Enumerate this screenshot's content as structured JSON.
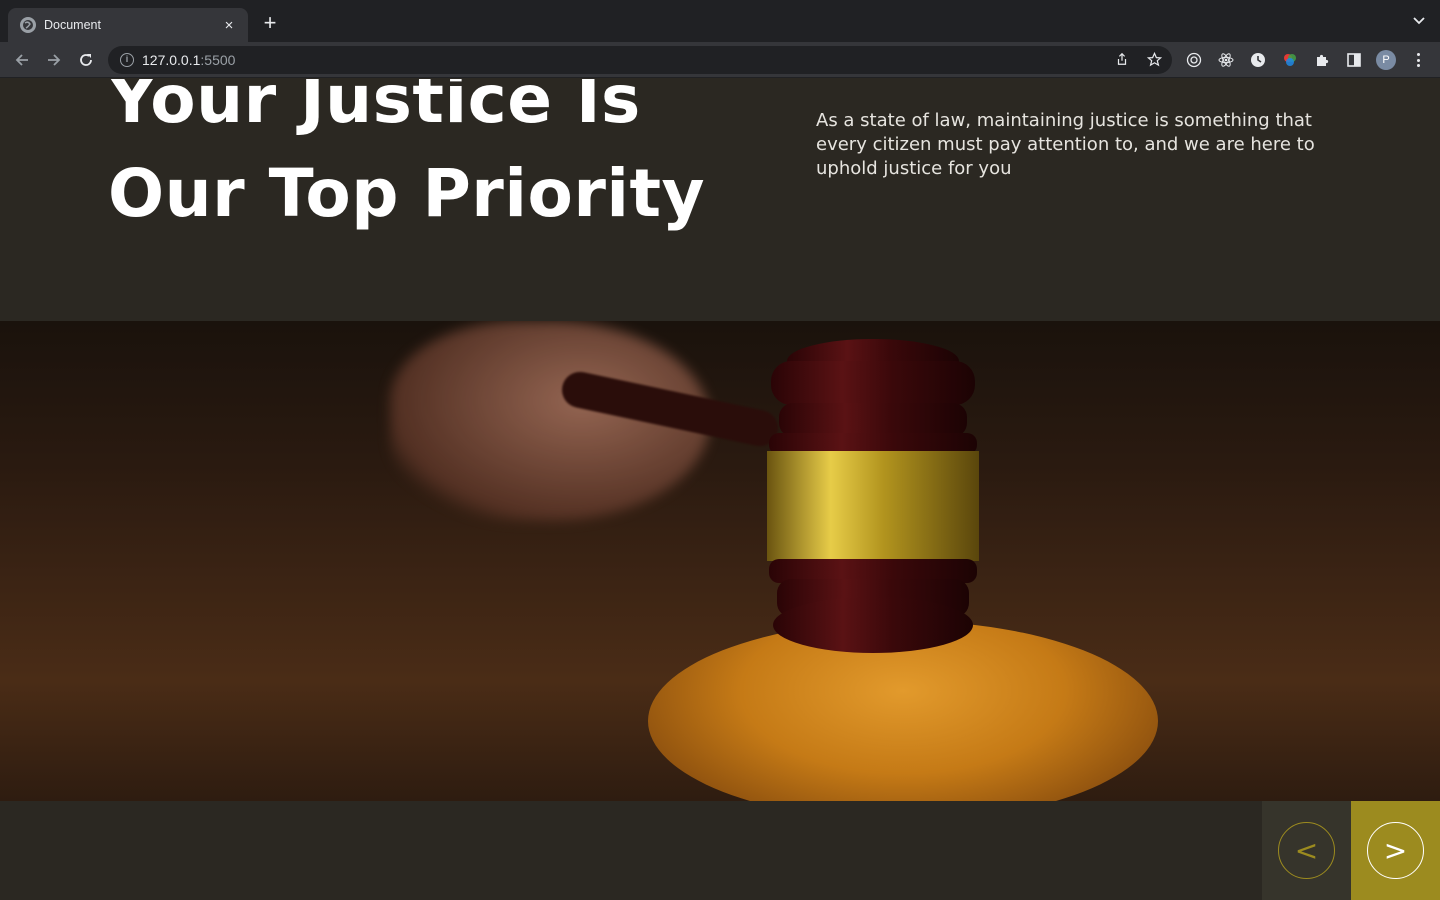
{
  "browser": {
    "tab_title": "Document",
    "tab_close": "×",
    "new_tab": "+",
    "url_host": "127.0.0.1",
    "url_port": ":5500",
    "avatar_letter": "P"
  },
  "hero": {
    "title_line1": "Your Justice Is",
    "title_line2": "Our Top Priority",
    "description": "As a state of law, maintaining justice is something that every citizen must pay attention to, and we are here to uphold justice for you"
  },
  "slider": {
    "prev_label": "<",
    "next_label": ">"
  },
  "colors": {
    "background": "#2b2822",
    "accent": "#9c8b1f",
    "prev_bg": "#36342b"
  }
}
